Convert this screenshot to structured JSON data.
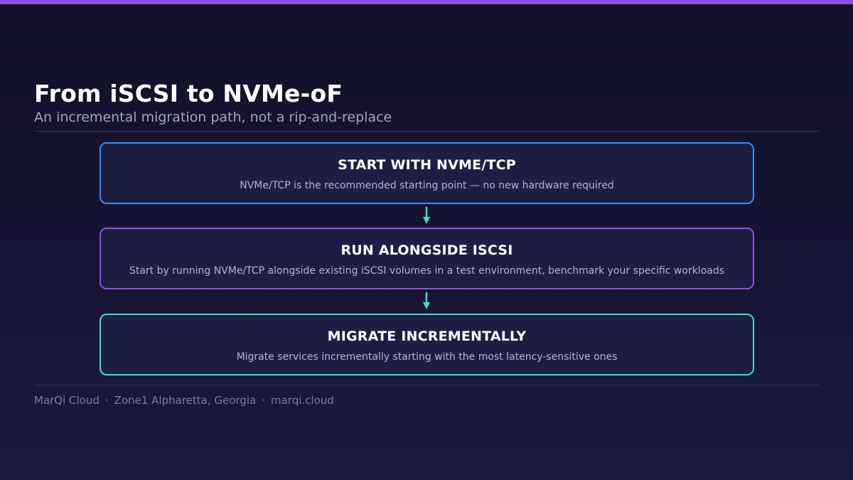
{
  "colors": {
    "accent_bar": "#8e4fd8",
    "arrow": "#3ee0c4"
  },
  "header": {
    "title": "From iSCSI to NVMe-oF",
    "subtitle": "An incremental migration path, not a rip-and-replace"
  },
  "steps": [
    {
      "title": "START WITH NVME/TCP",
      "description": "NVMe/TCP is the recommended starting point — no new hardware required",
      "border_color": "#3b8cf0"
    },
    {
      "title": "RUN ALONGSIDE ISCSI",
      "description": "Start by running NVMe/TCP alongside existing iSCSI volumes in a test environment, benchmark your specific workloads",
      "border_color": "#8f4fdb"
    },
    {
      "title": "MIGRATE INCREMENTALLY",
      "description": "Migrate services incrementally starting with the most latency-sensitive ones",
      "border_color": "#3ee0c4"
    }
  ],
  "footer": {
    "brand": "MarQi Cloud",
    "separator": "·",
    "location": "Zone1 Alpharetta, Georgia",
    "website": "marqi.cloud"
  }
}
